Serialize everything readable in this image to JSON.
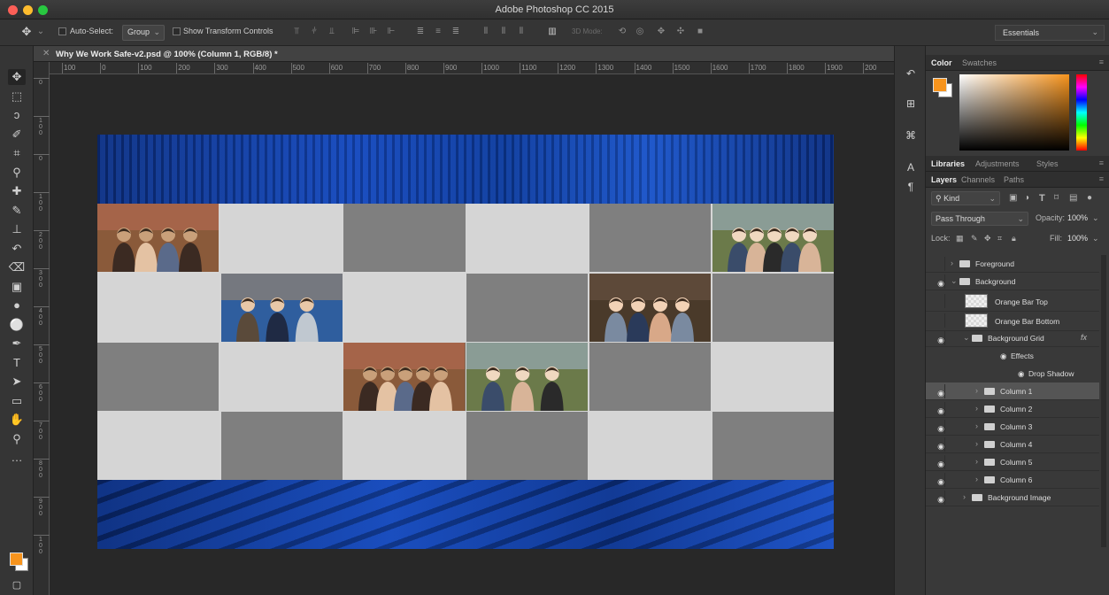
{
  "app": {
    "title": "Adobe Photoshop CC 2015"
  },
  "options_bar": {
    "tool_icon": "move-tool-icon",
    "auto_select_label": "Auto-Select:",
    "auto_select_checked": false,
    "auto_select_value": "Group",
    "show_transform_label": "Show Transform Controls",
    "show_transform_checked": false,
    "mode_3d_label": "3D Mode:",
    "workspace": "Essentials"
  },
  "document": {
    "tab_title": "Why We Work Safe-v2.psd @ 100% (Column 1, RGB/8) *"
  },
  "ruler": {
    "h_labels": [
      "100",
      "0",
      "100",
      "200",
      "300",
      "400",
      "500",
      "600",
      "700",
      "800",
      "900",
      "1000",
      "1100",
      "1200",
      "1300",
      "1400",
      "1500",
      "1600",
      "1700",
      "1800",
      "1900",
      "200"
    ],
    "v_labels": [
      "0",
      "100",
      "0",
      "100",
      "200",
      "300",
      "400",
      "500",
      "600",
      "700",
      "800",
      "900",
      "100"
    ]
  },
  "tools": [
    {
      "name": "move-tool-icon",
      "glyph": "✥",
      "active": true
    },
    {
      "name": "marquee-tool-icon",
      "glyph": "⬚"
    },
    {
      "name": "lasso-tool-icon",
      "glyph": "ↄ"
    },
    {
      "name": "quick-select-tool-icon",
      "glyph": "✐"
    },
    {
      "name": "crop-tool-icon",
      "glyph": "⌗"
    },
    {
      "name": "eyedropper-tool-icon",
      "glyph": "⚲"
    },
    {
      "name": "healing-brush-tool-icon",
      "glyph": "✚"
    },
    {
      "name": "brush-tool-icon",
      "glyph": "✎"
    },
    {
      "name": "clone-stamp-tool-icon",
      "glyph": "⊥"
    },
    {
      "name": "history-brush-tool-icon",
      "glyph": "↶"
    },
    {
      "name": "eraser-tool-icon",
      "glyph": "⌫"
    },
    {
      "name": "gradient-tool-icon",
      "glyph": "▣"
    },
    {
      "name": "blur-tool-icon",
      "glyph": "●"
    },
    {
      "name": "dodge-tool-icon",
      "glyph": "⚪"
    },
    {
      "name": "pen-tool-icon",
      "glyph": "✒"
    },
    {
      "name": "type-tool-icon",
      "glyph": "T"
    },
    {
      "name": "path-selection-tool-icon",
      "glyph": "➤"
    },
    {
      "name": "rectangle-tool-icon",
      "glyph": "▭"
    },
    {
      "name": "hand-tool-icon",
      "glyph": "✋"
    },
    {
      "name": "zoom-tool-icon",
      "glyph": "⚲"
    },
    {
      "name": "more-tools-icon",
      "glyph": "…"
    }
  ],
  "swatches": {
    "foreground": "#f7941d",
    "background": "#ffffff"
  },
  "color_panel": {
    "tabs": [
      "Color",
      "Swatches"
    ],
    "active_tab": "Color"
  },
  "libraries_panel": {
    "tabs": [
      "Libraries",
      "Adjustments",
      "Styles"
    ],
    "active_tab": "Libraries"
  },
  "layers_panel": {
    "tabs": [
      "Layers",
      "Channels",
      "Paths"
    ],
    "active_tab": "Layers",
    "filter_kind": "Kind",
    "blend_mode": "Pass Through",
    "opacity_label": "Opacity:",
    "opacity": "100%",
    "lock_label": "Lock:",
    "fill_label": "Fill:",
    "fill": "100%",
    "layers": [
      {
        "name": "Foreground",
        "type": "group",
        "visible": false,
        "expanded": false,
        "indent": 0
      },
      {
        "name": "Background",
        "type": "group",
        "visible": true,
        "expanded": true,
        "indent": 0
      },
      {
        "name": "Orange Bar Top",
        "type": "layer",
        "visible": false,
        "indent": 1
      },
      {
        "name": "Orange Bar Bottom",
        "type": "layer",
        "visible": false,
        "indent": 1
      },
      {
        "name": "Background Grid",
        "type": "group",
        "visible": true,
        "expanded": true,
        "indent": 1,
        "fx": true
      },
      {
        "name": "Effects",
        "type": "effects",
        "indent": 2
      },
      {
        "name": "Drop Shadow",
        "type": "effect",
        "indent": 3
      },
      {
        "name": "Column 1",
        "type": "group",
        "visible": true,
        "expanded": false,
        "indent": 2,
        "selected": true
      },
      {
        "name": "Column 2",
        "type": "group",
        "visible": true,
        "expanded": false,
        "indent": 2
      },
      {
        "name": "Column 3",
        "type": "group",
        "visible": true,
        "expanded": false,
        "indent": 2
      },
      {
        "name": "Column 4",
        "type": "group",
        "visible": true,
        "expanded": false,
        "indent": 2
      },
      {
        "name": "Column 5",
        "type": "group",
        "visible": true,
        "expanded": false,
        "indent": 2
      },
      {
        "name": "Column 6",
        "type": "group",
        "visible": true,
        "expanded": false,
        "indent": 2
      },
      {
        "name": "Background Image",
        "type": "group",
        "visible": true,
        "expanded": false,
        "indent": 1
      }
    ]
  },
  "canvas_grid": {
    "rows": [
      [
        "photo",
        "light",
        "dark",
        "light",
        "dark",
        "photo"
      ],
      [
        "light",
        "photo",
        "light",
        "dark",
        "photo",
        "dark"
      ],
      [
        "dark",
        "light",
        "photo",
        "photo",
        "dark",
        "light"
      ],
      [
        "light",
        "dark",
        "light",
        "dark",
        "light",
        "dark"
      ]
    ]
  }
}
